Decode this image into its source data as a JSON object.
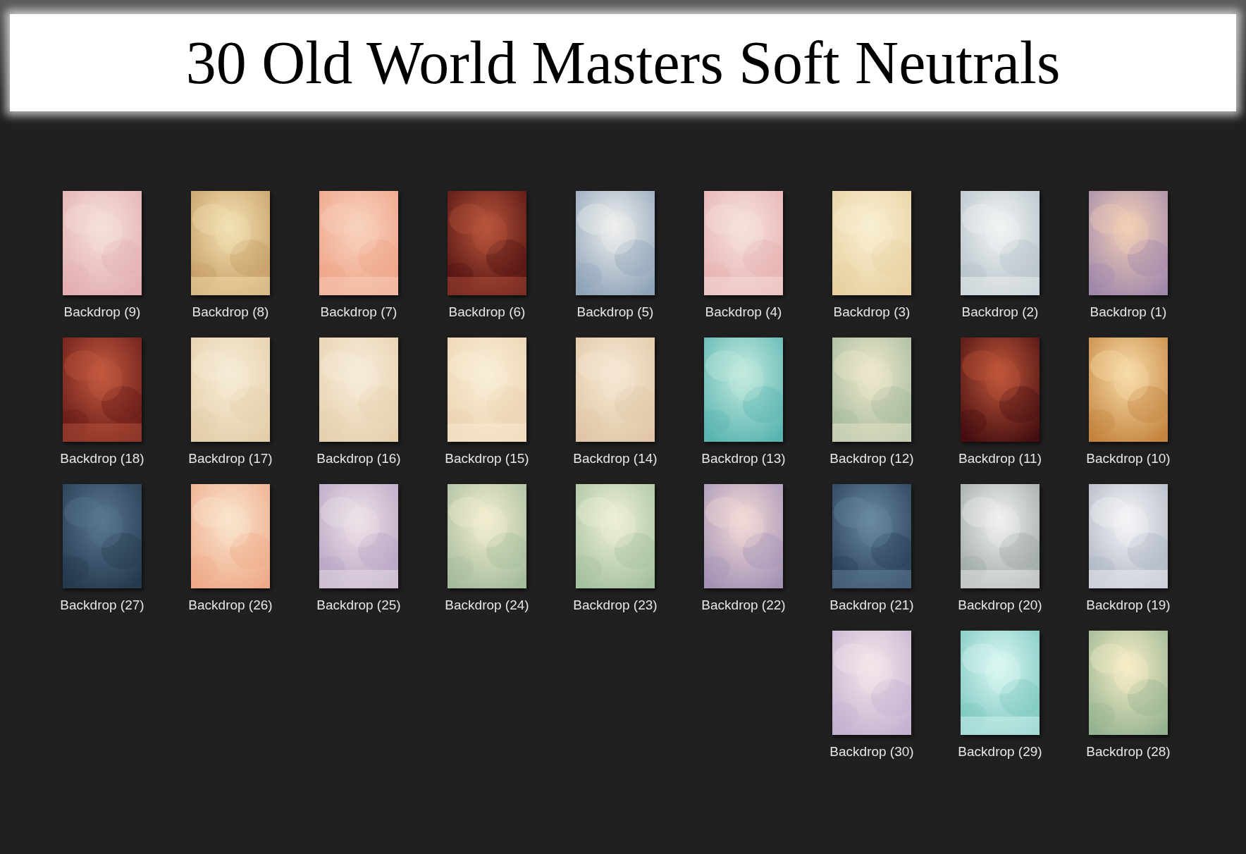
{
  "banner": {
    "title": "30 Old World Masters Soft Neutrals"
  },
  "rows": [
    [
      {
        "kind": "picture",
        "label": "Backdrop (9)"
      },
      {
        "kind": "picture",
        "label": "Backdrop (8)"
      },
      {
        "kind": "picture",
        "label": "Backdrop (7)"
      },
      {
        "kind": "picture",
        "label": "Backdrop (6)"
      },
      {
        "kind": "picture",
        "label": "Backdrop (5)"
      },
      {
        "kind": "picture",
        "label": "Backdrop (4)"
      },
      {
        "kind": "picture",
        "label": "Backdrop (3)"
      },
      {
        "kind": "picture",
        "label": "Backdrop (2)"
      },
      {
        "kind": "picture",
        "label": "Backdrop (1)"
      }
    ],
    [
      {
        "kind": "picture",
        "label": "Backdrop (18)"
      },
      {
        "kind": "picture",
        "label": "Backdrop (17)"
      },
      {
        "kind": "picture",
        "label": "Backdrop (16)"
      },
      {
        "kind": "picture",
        "label": "Backdrop (15)"
      },
      {
        "kind": "picture",
        "label": "Backdrop (14)"
      },
      {
        "kind": "picture",
        "label": "Backdrop (13)"
      },
      {
        "kind": "picture",
        "label": "Backdrop (12)"
      },
      {
        "kind": "picture",
        "label": "Backdrop (11)"
      },
      {
        "kind": "picture",
        "label": "Backdrop (10)"
      }
    ],
    [
      {
        "kind": "picture",
        "label": "Backdrop (27)"
      },
      {
        "kind": "picture",
        "label": "Backdrop (26)"
      },
      {
        "kind": "picture",
        "label": "Backdrop (25)"
      },
      {
        "kind": "picture",
        "label": "Backdrop (24)"
      },
      {
        "kind": "picture",
        "label": "Backdrop (23)"
      },
      {
        "kind": "picture",
        "label": "Backdrop (22)"
      },
      {
        "kind": "picture",
        "label": "Backdrop (21)"
      },
      {
        "kind": "picture",
        "label": "Backdrop (20)"
      },
      {
        "kind": "picture",
        "label": "Backdrop (19)"
      }
    ],
    [
      {
        "kind": "picture",
        "label": "Backdrop (30)"
      },
      {
        "kind": "picture",
        "label": "Backdrop (29)"
      },
      {
        "kind": "picture",
        "label": "Backdrop (28)"
      }
    ]
  ]
}
